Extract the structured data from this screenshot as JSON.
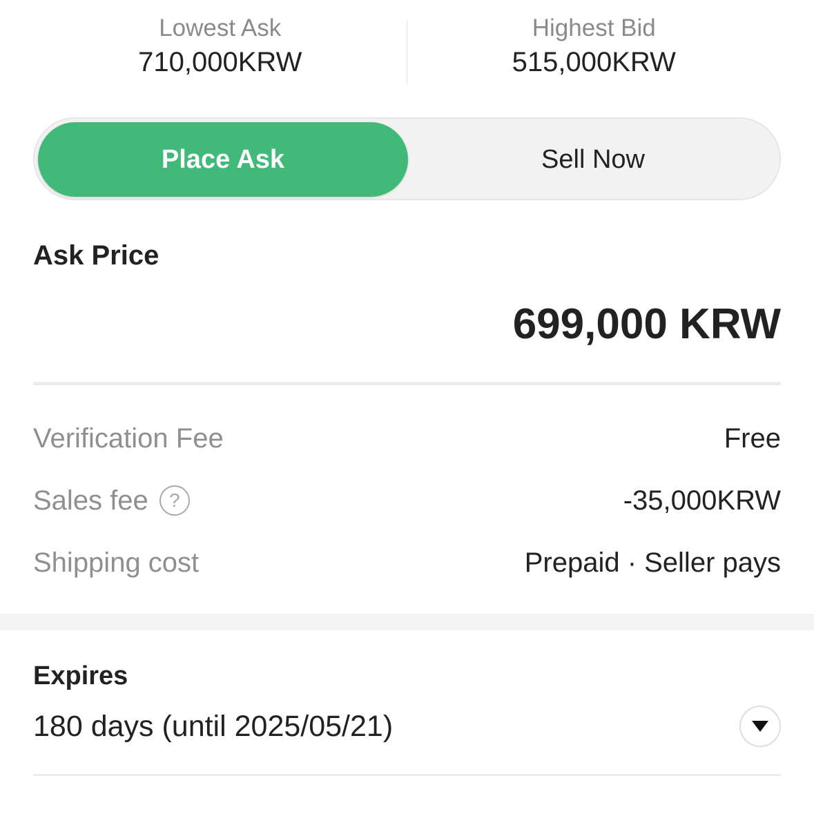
{
  "stats": {
    "lowest_ask": {
      "label": "Lowest Ask",
      "value": "710,000KRW"
    },
    "highest_bid": {
      "label": "Highest Bid",
      "value": "515,000KRW"
    }
  },
  "mode_toggle": {
    "place_ask_label": "Place Ask",
    "sell_now_label": "Sell Now",
    "selected": "Place Ask"
  },
  "ask": {
    "title": "Ask Price",
    "price": "699,000 KRW"
  },
  "fees": {
    "verification": {
      "label": "Verification Fee",
      "value": "Free"
    },
    "sales": {
      "label": "Sales fee",
      "value": "-35,000KRW",
      "help_icon_glyph": "?"
    },
    "shipping": {
      "label": "Shipping cost",
      "value": "Prepaid · Seller pays"
    }
  },
  "expires": {
    "title": "Expires",
    "value": "180 days (until 2025/05/21)"
  },
  "colors": {
    "accent": "#41b979",
    "muted_text": "#8f8f8f",
    "primary_text": "#222222"
  },
  "icons": {
    "help": "question-circle-icon",
    "dropdown": "caret-down-icon"
  }
}
